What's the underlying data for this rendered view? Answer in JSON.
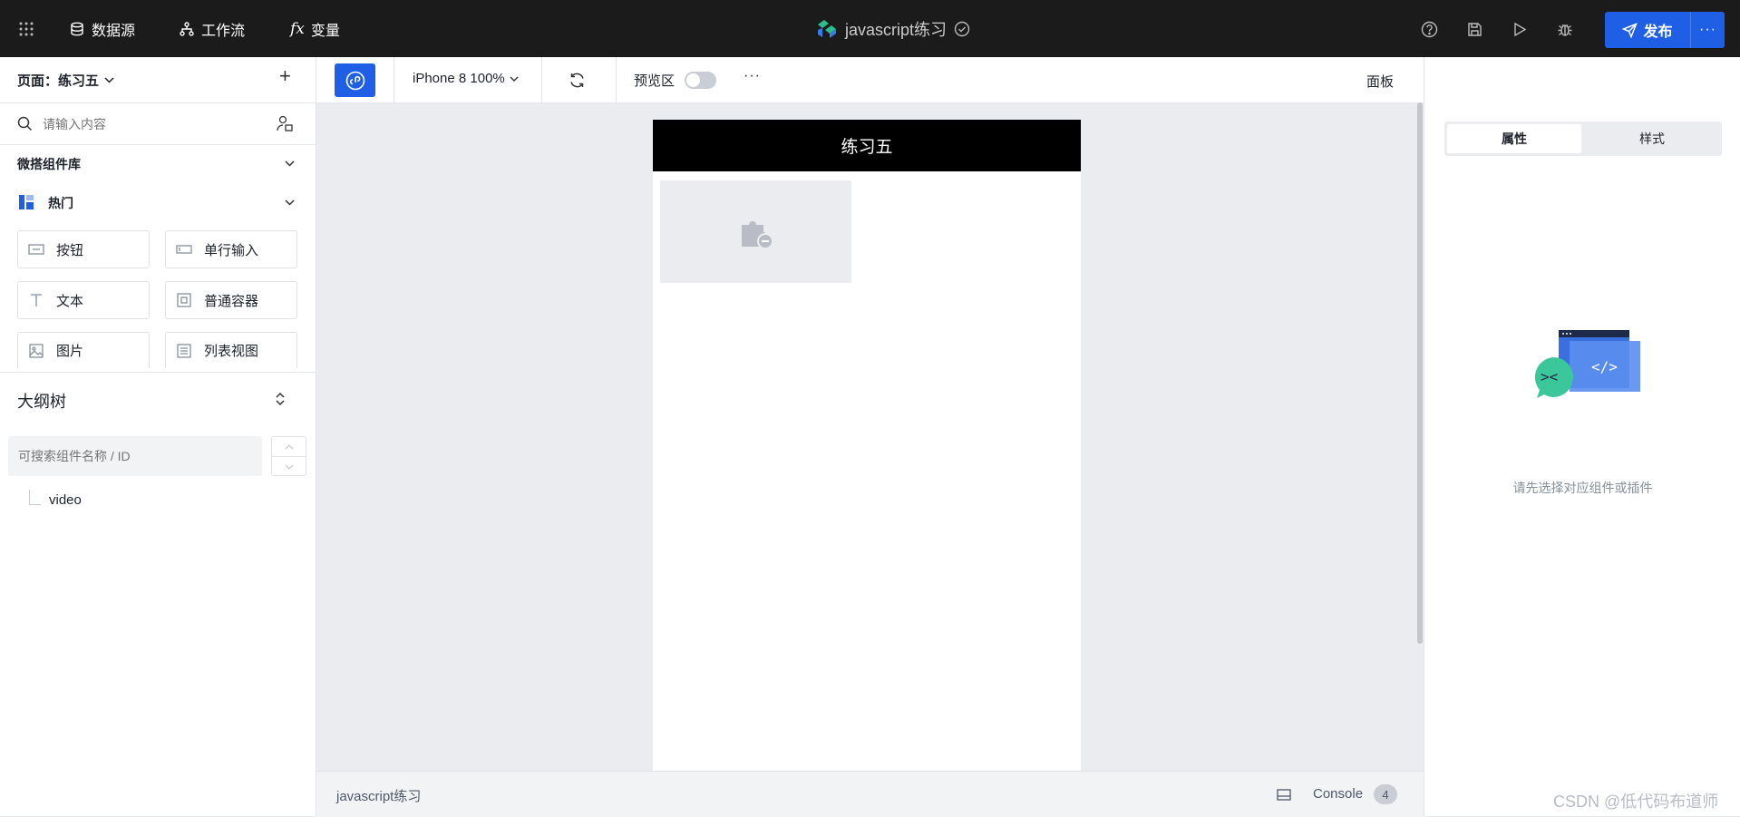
{
  "topbar": {
    "datasource": "数据源",
    "workflow": "工作流",
    "variables": "变量",
    "app_title": "javascript练习",
    "publish": "发布",
    "more": "···"
  },
  "left": {
    "page_label": "页面：练习五",
    "add": "+",
    "search_placeholder": "请输入内容",
    "library_title": "微搭组件库",
    "group_title": "热门",
    "components": [
      "按钮",
      "单行输入",
      "文本",
      "普通容器",
      "图片",
      "列表视图"
    ],
    "outline_title": "大纲树",
    "outline_search_placeholder": "可搜索组件名称 / ID",
    "tree_items": [
      "video"
    ]
  },
  "toolbar": {
    "device": "iPhone 8 100%",
    "preview": "预览区",
    "preview_on": false,
    "more": "···",
    "panel": "面板"
  },
  "canvas": {
    "page_title": "练习五"
  },
  "right": {
    "tabs": [
      "属性",
      "样式"
    ],
    "active_tab": "属性",
    "empty_hint": "请先选择对应组件或插件"
  },
  "status": {
    "app_name": "javascript练习",
    "console": "Console",
    "console_count": "4"
  },
  "watermark": "CSDN @低代码布道师",
  "colors": {
    "accent": "#1f5fe6",
    "topbar": "#1b1b1b"
  }
}
